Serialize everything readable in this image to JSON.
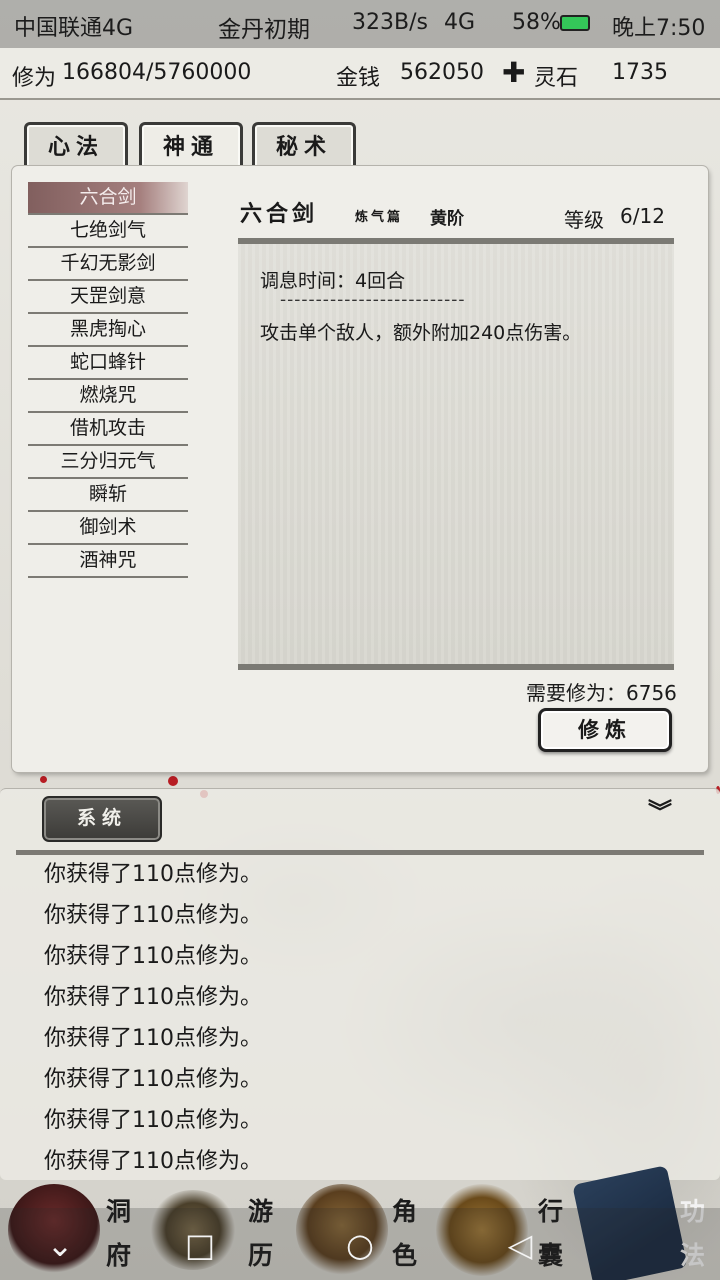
{
  "status_bar": {
    "carrier": "中国联通4G",
    "realm": "金丹初期",
    "speed": "323B/s",
    "signal": "4G",
    "battery": "58%",
    "time": "晚上7:50"
  },
  "resources": {
    "cultivation_label": "修为",
    "cultivation_value": "166804/5760000",
    "money_label": "金钱",
    "money_value": "562050",
    "stone_label": "灵石",
    "stone_value": "1735"
  },
  "tabs": [
    {
      "label": "心法"
    },
    {
      "label": "神通"
    },
    {
      "label": "秘术"
    }
  ],
  "skills": [
    {
      "name": "六合剑"
    },
    {
      "name": "七绝剑气"
    },
    {
      "name": "千幻无影剑"
    },
    {
      "name": "天罡剑意"
    },
    {
      "name": "黑虎掏心"
    },
    {
      "name": "蛇口蜂针"
    },
    {
      "name": "燃烧咒"
    },
    {
      "name": "借机攻击"
    },
    {
      "name": "三分归元气"
    },
    {
      "name": "瞬斩"
    },
    {
      "name": "御剑术"
    },
    {
      "name": "酒神咒"
    }
  ],
  "detail": {
    "title": "六合剑",
    "subtitle": "炼气篇",
    "grade": "黄阶",
    "level_label": "等级",
    "level_value": "6/12",
    "cooldown": "调息时间：4回合",
    "divider": "--------------------------",
    "effect": "攻击单个敌人，额外附加240点伤害。",
    "requirement": "需要修为：6756",
    "train_button": "修炼"
  },
  "log": {
    "system_button": "系统",
    "lines": [
      "你获得了110点修为。",
      "你获得了110点修为。",
      "你获得了110点修为。",
      "你获得了110点修为。",
      "你获得了110点修为。",
      "你获得了110点修为。",
      "你获得了110点修为。",
      "你获得了110点修为。"
    ]
  },
  "bottom_nav": [
    {
      "top": "洞",
      "bottom": "府"
    },
    {
      "top": "游",
      "bottom": "历"
    },
    {
      "top": "角",
      "bottom": "色"
    },
    {
      "top": "行",
      "bottom": "囊"
    },
    {
      "top": "功",
      "bottom": "法"
    }
  ],
  "colors": {
    "selected_skill": "#7a4c4c",
    "blossom": "#b71d23",
    "ink": "#1a1a1a"
  }
}
